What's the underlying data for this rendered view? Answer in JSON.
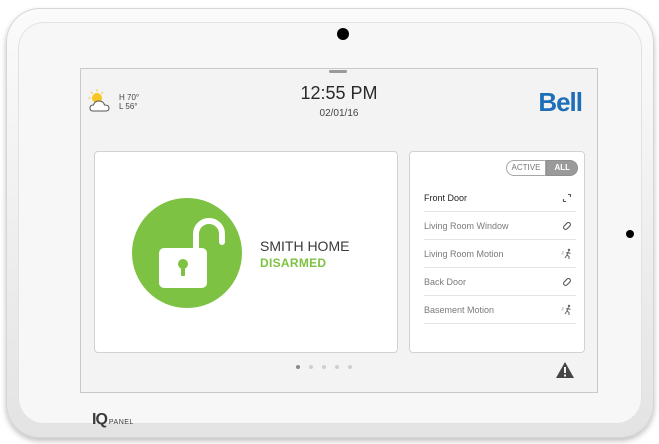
{
  "device": {
    "bezel_logo": "IQ",
    "bezel_logo_sub": "PANEL"
  },
  "header": {
    "weather": {
      "icon": "partly-cloudy-icon",
      "high": "H 70°",
      "low": "L 56°"
    },
    "time": "12:55 PM",
    "date": "02/01/16",
    "brand": "Bell"
  },
  "status": {
    "home_name": "SMITH HOME",
    "state": "DISARMED",
    "state_color": "#7dc242"
  },
  "sensors": {
    "filter_active": "ACTIVE",
    "filter_all": "ALL",
    "items": [
      {
        "name": "Front Door",
        "icon": "door-open-icon",
        "highlighted": true
      },
      {
        "name": "Living Room Window",
        "icon": "window-closed-icon",
        "highlighted": false
      },
      {
        "name": "Living Room Motion",
        "icon": "motion-icon",
        "highlighted": false
      },
      {
        "name": "Back Door",
        "icon": "door-closed-icon",
        "highlighted": false
      },
      {
        "name": "Basement Motion",
        "icon": "motion-icon",
        "highlighted": false
      }
    ]
  },
  "pager": {
    "pages": 5,
    "current": 1
  },
  "footer": {
    "alert_icon": "warning-icon"
  }
}
